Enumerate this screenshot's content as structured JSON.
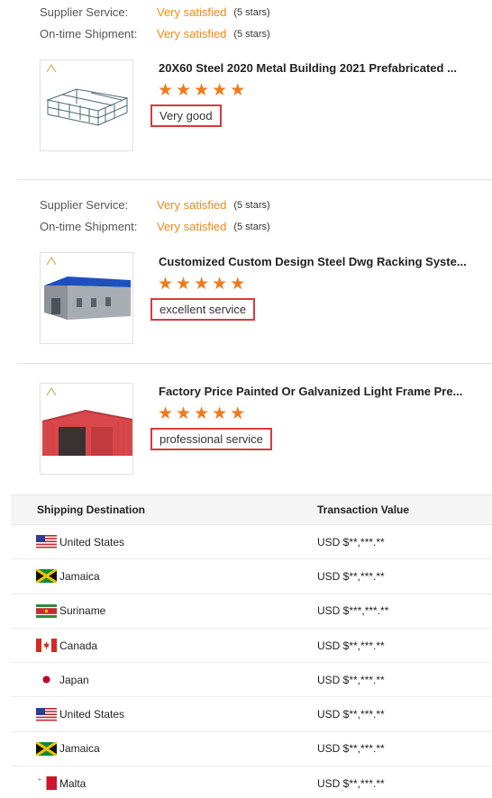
{
  "reviews": [
    {
      "supplier_label": "Supplier Service:",
      "supplier_value": "Very satisfied",
      "supplier_stars": "(5 stars)",
      "shipment_label": "On-time Shipment:",
      "shipment_value": "Very satisfied",
      "shipment_stars": "(5 stars)",
      "product_title": "20X60 Steel 2020 Metal Building 2021 Prefabricated ...",
      "rating": 5,
      "comment": "Very good"
    },
    {
      "supplier_label": "Supplier Service:",
      "supplier_value": "Very satisfied",
      "supplier_stars": "(5 stars)",
      "shipment_label": "On-time Shipment:",
      "shipment_value": "Very satisfied",
      "shipment_stars": "(5 stars)",
      "product_title": "Customized Custom Design Steel Dwg Racking Syste...",
      "rating": 5,
      "comment": "excellent service"
    },
    {
      "product_title": "Factory Price Painted Or Galvanized Light Frame Pre...",
      "rating": 5,
      "comment": "professional service"
    }
  ],
  "transactions": {
    "header_destination": "Shipping Destination",
    "header_value": "Transaction Value",
    "rows": [
      {
        "country": "United States",
        "flag": "us-flag-icon",
        "value": "USD $**,***.**"
      },
      {
        "country": "Jamaica",
        "flag": "jamaica-flag-icon",
        "value": "USD $**,***.**"
      },
      {
        "country": "Suriname",
        "flag": "suriname-flag-icon",
        "value": "USD $***,***.**"
      },
      {
        "country": "Canada",
        "flag": "canada-flag-icon",
        "value": "USD $**,***.**"
      },
      {
        "country": "Japan",
        "flag": "japan-flag-icon",
        "value": "USD $**,***.**"
      },
      {
        "country": "United States",
        "flag": "us-flag-icon",
        "value": "USD $**,***.**"
      },
      {
        "country": "Jamaica",
        "flag": "jamaica-flag-icon",
        "value": "USD $**,***.**"
      },
      {
        "country": "Malta",
        "flag": "malta-flag-icon",
        "value": "USD $**,***.**"
      }
    ]
  },
  "colors": {
    "accent_orange": "#f08a1c",
    "star_orange": "#f07a1d",
    "highlight_red": "#d93a3a"
  }
}
